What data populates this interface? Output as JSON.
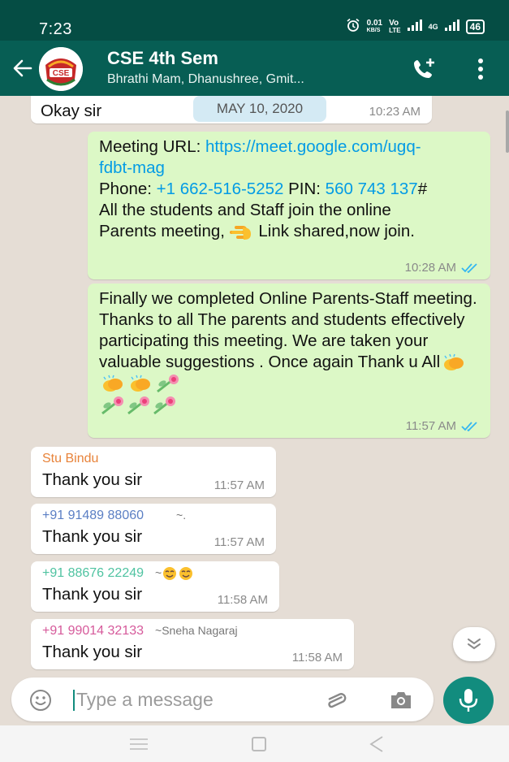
{
  "status_bar": {
    "time": "7:23",
    "alarm_icon": "alarm-icon",
    "net_speed_value": "0.01",
    "net_speed_unit": "KB/S",
    "volte_top": "Vo",
    "volte_bottom": "LTE",
    "signal_label": "4G",
    "battery": "46"
  },
  "header": {
    "title": "CSE 4th Sem",
    "subtitle": "Bhrathi Mam, Dhanushree, Gmit...",
    "avatar_text": "CSE"
  },
  "chat": {
    "date_chip": "MAY 10, 2020",
    "messages": [
      {
        "text": "Okay sir",
        "time": "10:23 AM"
      },
      {
        "meeting_label": "Meeting URL: ",
        "meeting_link": "https://meet.google.com/ugq-fdbt-mag",
        "phone_label": "Phone: ",
        "phone_number": "+1 662-516-5252",
        "pin_label": " PIN: ",
        "pin_number": "560 743 137",
        "pin_suffix": "#",
        "body_1": "All the students and Staff join the online Parents meeting, ",
        "body_2": " Link shared,now join.",
        "time": "10:28 AM"
      },
      {
        "text": "Finally we completed Online Parents-Staff meeting. Thanks to all The parents and students  effectively participating this meeting. We are taken your valuable suggestions . Once again Thank u All",
        "time": "11:57 AM"
      },
      {
        "sender": "Stu Bindu",
        "alias": "",
        "text": "Thank you sir",
        "time": "11:57 AM"
      },
      {
        "sender": "+91 91489 88060",
        "alias": "~.",
        "text": "Thank you sir",
        "time": "11:57 AM"
      },
      {
        "sender": "+91 88676 22249",
        "alias": "~",
        "text": "Thank you sir",
        "time": "11:58 AM"
      },
      {
        "sender": "+91 99014 32133",
        "alias": "~Sneha Nagaraj",
        "text": "Thank you sir",
        "time": "11:58 AM"
      }
    ]
  },
  "composer": {
    "placeholder": "Type a message"
  },
  "colors": {
    "header": "#075e54",
    "status_bar": "#054d44",
    "outgoing": "#dcf8c6",
    "incoming": "#ffffff",
    "link": "#039be5",
    "sender_1": "#e8833a",
    "sender_2": "#5b7fc4",
    "sender_3": "#4fc3a1",
    "sender_4": "#d65a9b",
    "mic": "#128c7e"
  },
  "icons": [
    "back-arrow-icon",
    "add-call-icon",
    "more-vert-icon",
    "double-tick-icon",
    "pointing-hand-icon",
    "clapping-hands-icon",
    "flower-icon",
    "smile-emoji-icon",
    "chevron-down-icon",
    "smiley-icon",
    "paperclip-icon",
    "camera-icon",
    "mic-icon",
    "nav-menu-icon",
    "nav-home-icon",
    "nav-back-icon"
  ]
}
